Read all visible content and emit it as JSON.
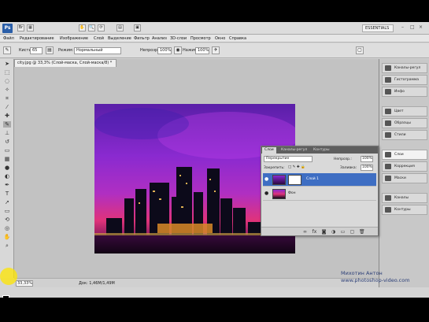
{
  "appbar": {
    "logo": "Ps",
    "workspace": "ESSENTIALS",
    "window_controls": [
      "–",
      "□",
      "×"
    ]
  },
  "menu": [
    "Файл",
    "Редактирование",
    "Изображение",
    "Слой",
    "Выделение",
    "Фильтр",
    "Анализ",
    "3D-слои",
    "Просмотр",
    "Окно",
    "Справка"
  ],
  "options": {
    "brush_label": "Кисть:",
    "brush_size": "65",
    "mode_label": "Режим:",
    "mode_value": "Нормальный",
    "opacity_label": "Непрозр.:",
    "opacity_value": "100%",
    "flow_label": "Нажим:",
    "flow_value": "100%"
  },
  "document": {
    "tab_title": "city.jpg @ 33,3% (Слой-маска, Слой-маска/8) *",
    "zoom": "33,33%",
    "doc_info": "Док: 1,46M/1,49M"
  },
  "dock": {
    "group1": [
      "Каналы-регул",
      "Гистограмма",
      "Инфо"
    ],
    "group2": [
      "Цвет",
      "Образцы",
      "Стили"
    ],
    "group3": [
      "Слои",
      "Коррекция",
      "Маски"
    ],
    "group4": [
      "Каналы",
      "Контуры"
    ]
  },
  "layers_panel": {
    "tabs": [
      "Слои",
      "Каналы-регул",
      "Контуры"
    ],
    "blend_mode": "Перекрытие",
    "opacity_label": "Непрозр.:",
    "opacity_value": "100%",
    "lock_label": "Закрепить:",
    "fill_label": "Заливка:",
    "fill_value": "100%",
    "layers": [
      {
        "name": "Слой 1",
        "selected": true
      },
      {
        "name": "Фон",
        "selected": false
      }
    ]
  },
  "watermark": {
    "line1": "Михотин Антон",
    "line2": "www.photoshop-video.com"
  },
  "colors": {
    "accent": "#3e6ec3",
    "foreground": "#000000",
    "background": "#ffffff"
  }
}
